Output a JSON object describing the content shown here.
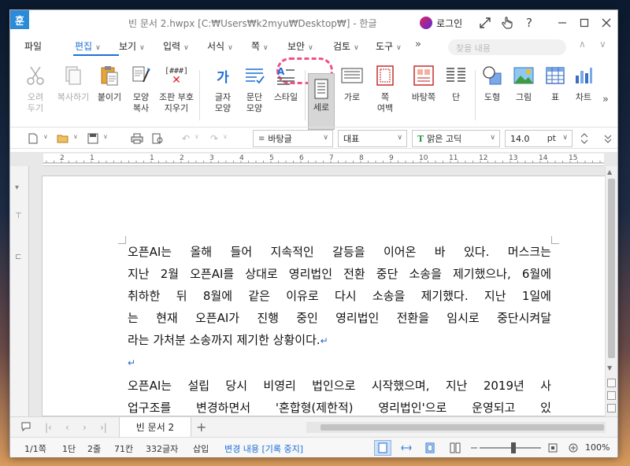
{
  "titlebar": {
    "app_icon": "훈",
    "title": "빈 문서 2.hwpx [C:₩Users₩k2myu₩Desktop₩] - 한글",
    "login_label": "로그인",
    "icons": [
      "expand-icon",
      "hand-pointer-icon",
      "help-icon",
      "minimize-icon",
      "maximize-icon",
      "close-icon"
    ]
  },
  "menu": {
    "items": [
      "파일",
      "편집",
      "보기",
      "입력",
      "서식",
      "쪽",
      "보안",
      "검토",
      "도구"
    ],
    "overflow": "»",
    "find_placeholder": "찾을 내용",
    "active": "편집",
    "highlighted": "보안"
  },
  "ribbon": {
    "buttons": [
      {
        "label": "오려\n두기",
        "icon": "scissors-icon",
        "disabled": true
      },
      {
        "label": "복사하기",
        "icon": "copy-icon",
        "disabled": true
      },
      {
        "label": "붙이기",
        "icon": "paste-icon",
        "disabled": false
      },
      {
        "label": "모양\n복사",
        "icon": "format-painter-icon",
        "disabled": false
      },
      {
        "label": "조판 부호\n지우기",
        "icon": "clear-codes-icon",
        "disabled": false,
        "glyph": "[###]"
      },
      {
        "label": "글자\n모양",
        "icon": "char-shape-icon",
        "disabled": false,
        "glyph": "가"
      },
      {
        "label": "문단\n모양",
        "icon": "para-shape-icon",
        "disabled": false
      },
      {
        "label": "스타일",
        "icon": "style-icon",
        "disabled": false
      },
      {
        "label": "세로",
        "icon": "portrait-icon",
        "disabled": false,
        "selected": true
      },
      {
        "label": "가로",
        "icon": "landscape-icon",
        "disabled": false
      },
      {
        "label": "쪽\n여백",
        "icon": "page-margin-icon",
        "disabled": false
      },
      {
        "label": "바탕쪽",
        "icon": "master-page-icon",
        "disabled": false
      },
      {
        "label": "단",
        "icon": "columns-icon",
        "disabled": false
      },
      {
        "label": "도형",
        "icon": "shapes-icon",
        "disabled": false
      },
      {
        "label": "그림",
        "icon": "picture-icon",
        "disabled": false
      },
      {
        "label": "표",
        "icon": "table-icon",
        "disabled": false
      },
      {
        "label": "차트",
        "icon": "chart-icon",
        "disabled": false
      }
    ],
    "more": "»"
  },
  "format": {
    "style": "바탕글",
    "language": "대표",
    "font": "맑은 고딕",
    "font_glyph": "T",
    "size": "14.0",
    "unit": "pt"
  },
  "ruler": {
    "numbers": [
      "2",
      "1",
      "1",
      "2",
      "3",
      "4",
      "5",
      "6",
      "7",
      "8",
      "9",
      "10",
      "11",
      "12",
      "13",
      "14",
      "15",
      "16"
    ]
  },
  "document": {
    "para1": [
      "오픈AI는 올해 들어 지속적인 갈등을 이어온 바 있다. 머스크는",
      "지난 2월 오픈AI를 상대로 영리법인 전환 중단 소송을 제기했으나, 6월에",
      "취하한 뒤 8월에 같은 이유로 다시 소송을 제기했다. 지난 1일에",
      "는 현재 오픈AI가 진행 중인 영리법인 전환을 임시로 중단시켜달",
      "라는 가처분 소송까지 제기한 상황이다."
    ],
    "return_mark": "↵",
    "para2": [
      "오픈AI는 설립 당시 비영리 법인으로 시작했으며, 지난 2019년 사",
      "업구조를 변경하면서 '혼합형(제한적) 영리법인'으로 운영되고 있"
    ]
  },
  "tabs": {
    "doc_tab": "빈 문서 2",
    "add": "+"
  },
  "status": {
    "page": "1/1쪽",
    "column": "1단",
    "line": "2줄",
    "col": "71칸",
    "chars": "332글자",
    "mode": "삽입",
    "track": "변경 내용 [기록 중지]",
    "zoom": "100%"
  },
  "colors": {
    "accent": "#1f6fd6",
    "highlight": "#f0508a",
    "app_icon": "#2b8bd6"
  }
}
